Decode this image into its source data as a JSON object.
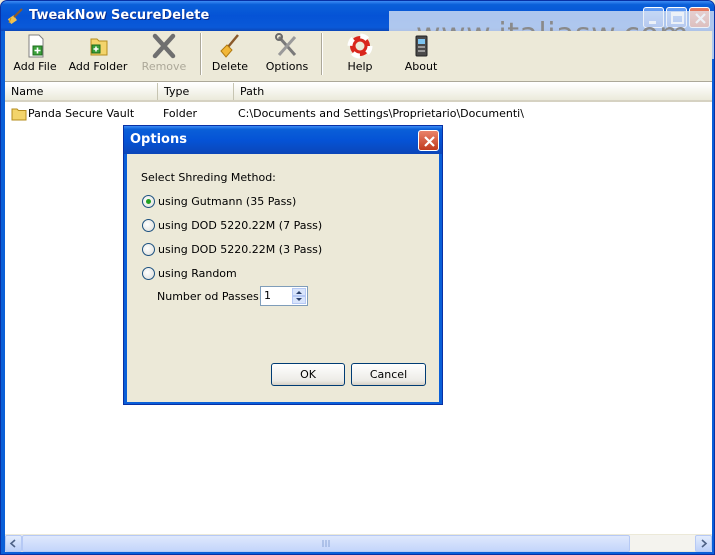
{
  "window": {
    "title": "TweakNow SecureDelete"
  },
  "watermark": "www.italiasw.com",
  "toolbar": {
    "add_file": "Add File",
    "add_folder": "Add Folder",
    "remove": "Remove",
    "delete": "Delete",
    "options": "Options",
    "help": "Help",
    "about": "About"
  },
  "list": {
    "columns": {
      "name": "Name",
      "type": "Type",
      "path": "Path"
    },
    "rows": [
      {
        "name": "Panda Secure Vault",
        "type": "Folder",
        "path": "C:\\Documents and Settings\\Proprietario\\Documenti\\"
      }
    ]
  },
  "dialog": {
    "title": "Options",
    "prompt": "Select Shreding Method:",
    "methods": [
      {
        "label": "using Gutmann (35 Pass)",
        "selected": true
      },
      {
        "label": "using DOD 5220.22M (7 Pass)",
        "selected": false
      },
      {
        "label": "using DOD 5220.22M (3 Pass)",
        "selected": false
      },
      {
        "label": "using Random",
        "selected": false
      }
    ],
    "passes_label": "Number od Passes:",
    "passes_value": "1",
    "ok": "OK",
    "cancel": "Cancel"
  }
}
